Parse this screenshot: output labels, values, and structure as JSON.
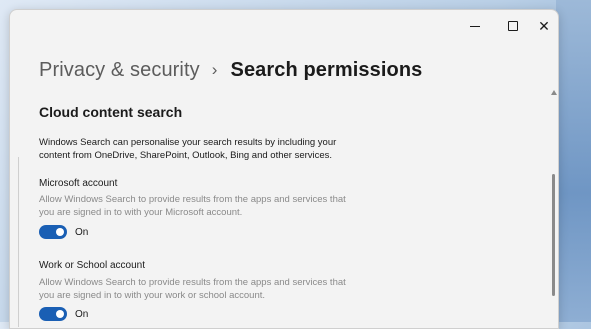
{
  "window": {
    "minimize_glyph": "",
    "maximize_glyph": "",
    "close_glyph": "✕"
  },
  "breadcrumb": {
    "parent": "Privacy & security",
    "separator": "›",
    "current": "Search permissions"
  },
  "section": {
    "title": "Cloud content search",
    "description": "Windows Search can personalise your search results by including your content from OneDrive, SharePoint, Outlook, Bing and other services."
  },
  "microsoft_account": {
    "label": "Microsoft account",
    "description": "Allow Windows Search to provide results from the apps and services that you are signed in to with your Microsoft account.",
    "toggle_state": "On",
    "enabled": true
  },
  "work_account": {
    "label": "Work or School account",
    "description": "Allow Windows Search to provide results from the apps and services that you are signed in to with your work or school account.",
    "toggle_state": "On",
    "enabled": true
  },
  "colors": {
    "accent": "#1a5fb4",
    "window_bg": "#f3f3f3",
    "muted_text": "#8a8a8a"
  }
}
